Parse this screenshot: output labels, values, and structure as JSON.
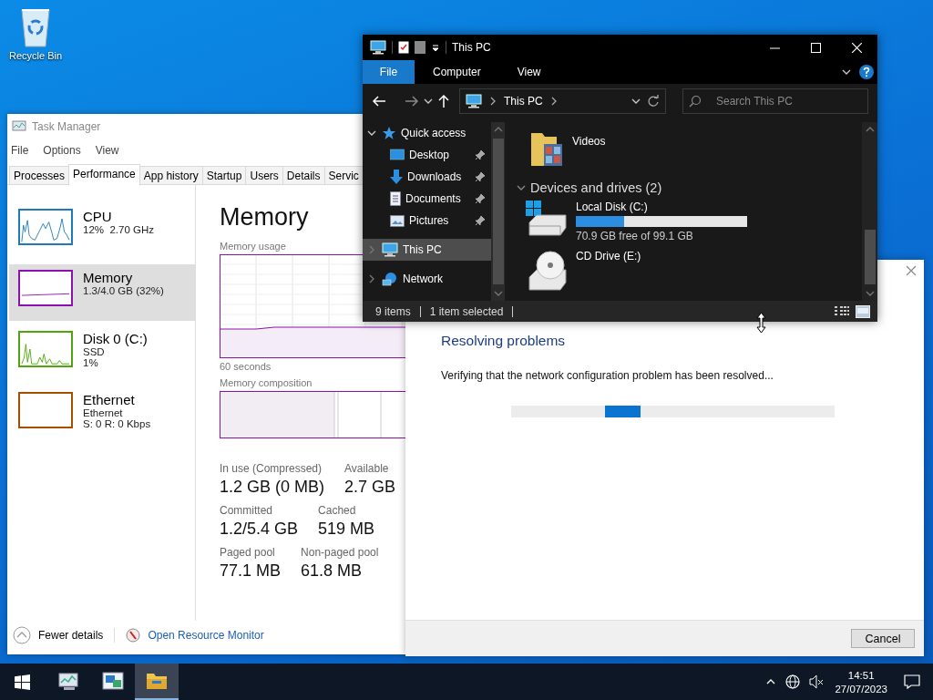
{
  "desktop_icons": [
    {
      "label": "Recycle Bin"
    }
  ],
  "task_manager": {
    "title": "Task Manager",
    "menu": [
      "File",
      "Options",
      "View"
    ],
    "tabs": [
      {
        "label": "Processes",
        "selected": false
      },
      {
        "label": "Performance",
        "selected": true
      },
      {
        "label": "App history",
        "selected": false
      },
      {
        "label": "Startup",
        "selected": false
      },
      {
        "label": "Users",
        "selected": false
      },
      {
        "label": "Details",
        "selected": false
      },
      {
        "label": "Servic",
        "selected": false
      }
    ],
    "resources": [
      {
        "name": "CPU",
        "lines": [
          "12%  2.70 GHz"
        ],
        "color": "#1f7ab8",
        "selected": false
      },
      {
        "name": "Memory",
        "lines": [
          "1.3/4.0 GB (32%)"
        ],
        "color": "#8b12ae",
        "selected": true
      },
      {
        "name": "Disk 0 (C:)",
        "lines": [
          "SSD",
          "1%"
        ],
        "color": "#4da60c",
        "selected": false
      },
      {
        "name": "Ethernet",
        "lines": [
          "Ethernet",
          "S: 0 R: 0 Kbps"
        ],
        "color": "#a74f01",
        "selected": false
      }
    ],
    "heading": "Memory",
    "usage_label": "Memory usage",
    "time_label": "60 seconds",
    "composition_label": "Memory composition",
    "stat_rows": [
      {
        "stats": [
          {
            "label": "In use (Compressed)",
            "value": "1.2 GB (0 MB)"
          },
          {
            "label": "Available",
            "value": "2.7 GB"
          }
        ]
      },
      {
        "stats": [
          {
            "label": "Committed",
            "value": "1.2/5.4 GB"
          },
          {
            "label": "Cached",
            "value": "519 MB"
          }
        ]
      },
      {
        "stats": [
          {
            "label": "Paged pool",
            "value": "77.1 MB"
          },
          {
            "label": "Non-paged pool",
            "value": "61.8 MB"
          }
        ]
      }
    ],
    "fewer_details": "Fewer details",
    "resource_monitor": "Open Resource Monitor"
  },
  "explorer": {
    "title": "This PC",
    "file_tab": "File",
    "ribbon_tabs": [
      "Computer",
      "View"
    ],
    "address": "This PC",
    "search": {
      "placeholder": "Search This PC"
    },
    "nav": [
      {
        "label": "Quick access",
        "expanded": true,
        "selected": false,
        "children": [
          {
            "label": "Desktop",
            "pinned": true
          },
          {
            "label": "Downloads",
            "pinned": true
          },
          {
            "label": "Documents",
            "pinned": true
          },
          {
            "label": "Pictures",
            "pinned": true
          }
        ]
      },
      {
        "label": "This PC",
        "expanded": false,
        "selected": true
      },
      {
        "label": "Network",
        "expanded": false,
        "selected": false
      }
    ],
    "folders": [
      {
        "name": "Videos"
      }
    ],
    "group": {
      "label": "Devices and drives (2)",
      "expanded": true
    },
    "drives": [
      {
        "kind": "disk",
        "name": "Local Disk (C:)",
        "level": 0.28,
        "free": "70.9 GB free of 99.1 GB"
      },
      {
        "kind": "cd",
        "name": "CD Drive (E:)"
      }
    ],
    "status": [
      "9 items",
      "1 item selected"
    ]
  },
  "troubleshooter": {
    "title": "Resolving problems",
    "message": "Verifying that the network configuration problem has been resolved...",
    "cancel": "Cancel"
  },
  "taskbar": {
    "apps": [
      {
        "active": false
      },
      {
        "active": false
      },
      {
        "active": true
      }
    ],
    "time": "14:51",
    "date": "27/07/2023"
  }
}
